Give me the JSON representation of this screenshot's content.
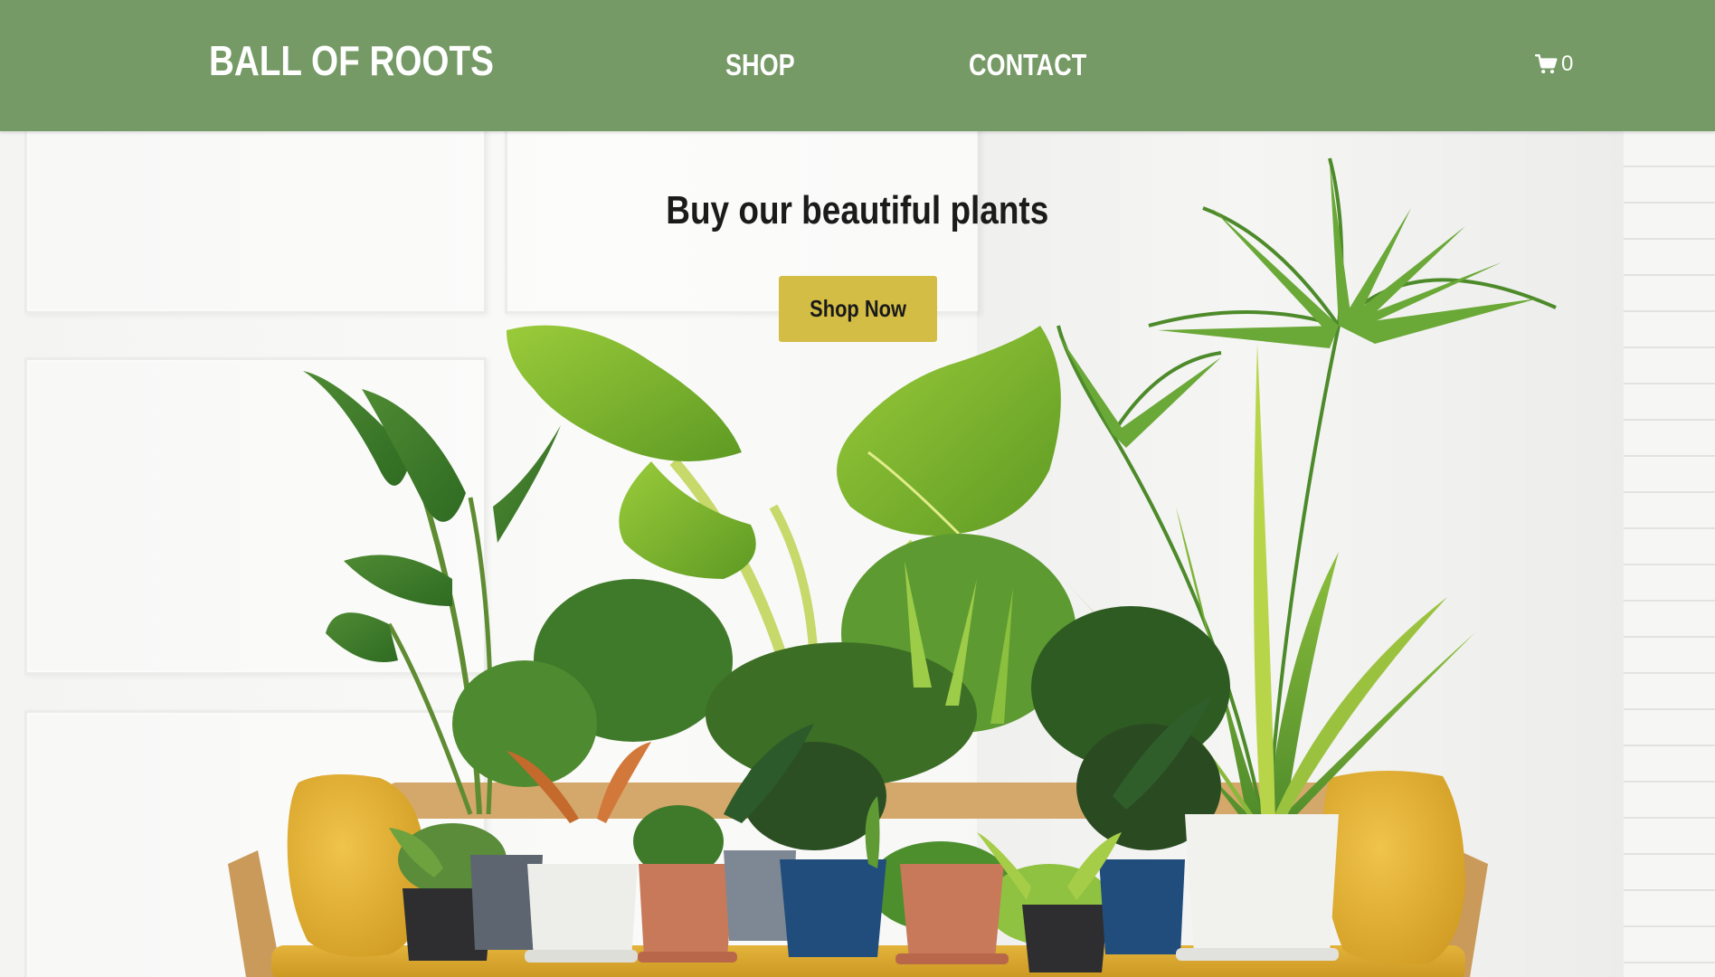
{
  "header": {
    "brand": "BALL OF ROOTS",
    "nav": [
      {
        "label": "SHOP"
      },
      {
        "label": "CONTACT"
      }
    ],
    "cart": {
      "icon": "shopping-cart-icon",
      "count": "0"
    }
  },
  "hero": {
    "headline": "Buy our beautiful plants",
    "cta_label": "Shop Now",
    "image": "potted-plants-on-yellow-bench"
  },
  "colors": {
    "nav_background": "#769a66",
    "nav_text": "#ffffff",
    "cta_background": "#d3bd45",
    "headline_text": "#1b1b1b"
  }
}
